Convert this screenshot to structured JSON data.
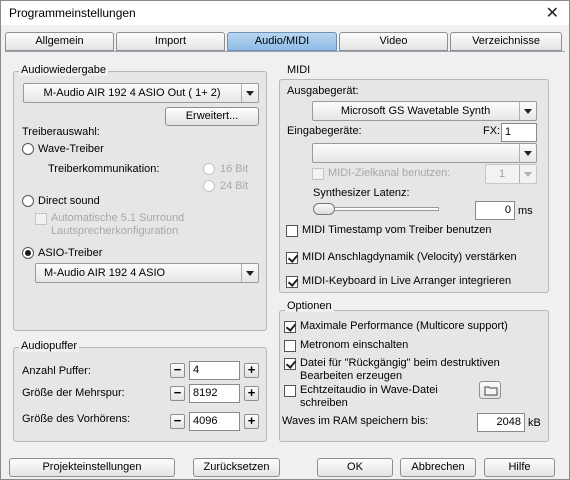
{
  "window": {
    "title": "Programmeinstellungen"
  },
  "tabs": [
    {
      "label": "Allgemein",
      "active": false
    },
    {
      "label": "Import",
      "active": false
    },
    {
      "label": "Audio/MIDI",
      "active": true
    },
    {
      "label": "Video",
      "active": false
    },
    {
      "label": "Verzeichnisse",
      "active": false
    }
  ],
  "audiowiedergabe": {
    "title": "Audiowiedergabe",
    "device": "M-Audio AIR 192 4 ASIO Out ( 1+ 2)",
    "advanced_button": "Erweitert...",
    "driver_label": "Treiberauswahl:",
    "wave_driver": "Wave-Treiber",
    "driver_comm": "Treiberkommunikation:",
    "bit16": "16 Bit",
    "bit24": "24 Bit",
    "direct_sound": "Direct sound",
    "auto_surround": "Automatische 5.1 Surround Lautsprecherkonfiguration",
    "asio_driver": "ASIO-Treiber",
    "asio_device": "M-Audio AIR 192 4 ASIO"
  },
  "audiopuffer": {
    "title": "Audiopuffer",
    "rows": [
      {
        "label": "Anzahl Puffer:",
        "value": "4"
      },
      {
        "label": "Größe der Mehrspur:",
        "value": "8192"
      },
      {
        "label": "Größe des Vorhörens:",
        "value": "4096"
      }
    ],
    "minus": "−",
    "plus": "+"
  },
  "midi": {
    "title": "MIDI",
    "output_label": "Ausgabegerät:",
    "output_device": "Microsoft GS Wavetable Synth",
    "input_label": "Eingabegeräte:",
    "fx_label": "FX:",
    "fx_value": "1",
    "input_device": "",
    "target_channel": "MIDI-Zielkanal benutzen:",
    "target_channel_value": "1",
    "latency_label": "Synthesizer Latenz:",
    "latency_value": "0",
    "latency_unit": "ms",
    "latency_level": 0,
    "timestamp": "MIDI Timestamp vom Treiber benutzen",
    "velocity": "MIDI Anschlagdynamik (Velocity) verstärken",
    "keyboard": "MIDI-Keyboard in Live Arranger integrieren"
  },
  "optionen": {
    "title": "Optionen",
    "max_perf": "Maximale Performance (Multicore support)",
    "metronome": "Metronom einschalten",
    "undo_file": "Datei für \"Rückgängig\" beim destruktiven Bearbeiten erzeugen",
    "realtime": "Echtzeitaudio in Wave-Datei schreiben",
    "ram_label": "Waves im RAM speichern bis:",
    "ram_value": "2048",
    "ram_unit": "kB"
  },
  "footer": {
    "project_settings": "Projekteinstellungen",
    "reset": "Zurücksetzen",
    "ok": "OK",
    "cancel": "Abbrechen",
    "help": "Hilfe"
  }
}
